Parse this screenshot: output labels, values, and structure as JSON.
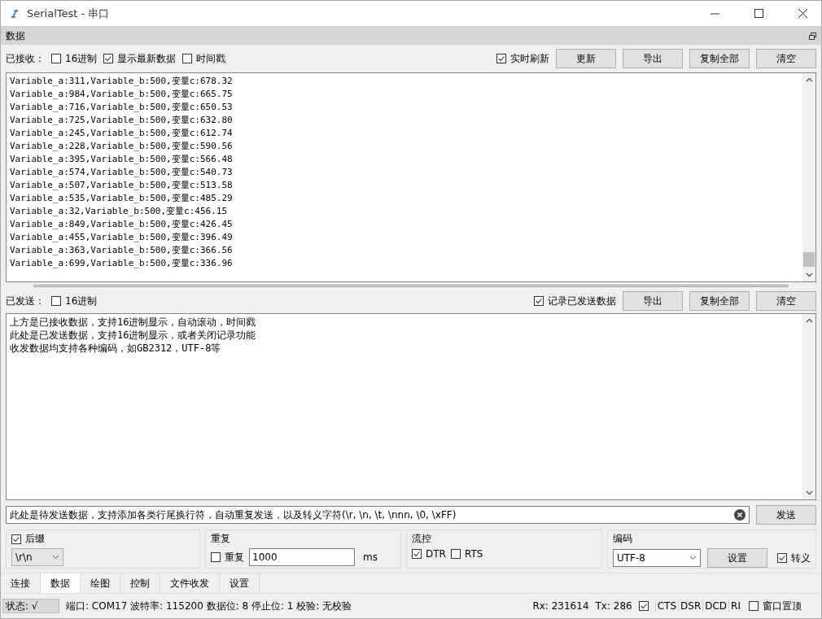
{
  "window": {
    "title": "SerialTest - 串口"
  },
  "panel": {
    "title": "数据"
  },
  "receive": {
    "label": "已接收：",
    "options": [
      {
        "label": "16进制",
        "checked": false
      },
      {
        "label": "显示最新数据",
        "checked": true
      },
      {
        "label": "时间戳",
        "checked": false
      }
    ],
    "realtime": {
      "label": "实时刷新",
      "checked": true
    },
    "buttons": [
      "更新",
      "导出",
      "复制全部",
      "清空"
    ],
    "lines": [
      "Variable_a:311,Variable_b:500,变量c:678.32",
      "Variable_a:984,Variable_b:500,变量c:665.75",
      "Variable_a:716,Variable_b:500,变量c:650.53",
      "Variable_a:725,Variable_b:500,变量c:632.80",
      "Variable_a:245,Variable_b:500,变量c:612.74",
      "Variable_a:228,Variable_b:500,变量c:590.56",
      "Variable_a:395,Variable_b:500,变量c:566.48",
      "Variable_a:574,Variable_b:500,变量c:540.73",
      "Variable_a:507,Variable_b:500,变量c:513.58",
      "Variable_a:535,Variable_b:500,变量c:485.29",
      "Variable_a:32,Variable_b:500,变量c:456.15",
      "Variable_a:849,Variable_b:500,变量c:426.45",
      "Variable_a:455,Variable_b:500,变量c:396.49",
      "Variable_a:363,Variable_b:500,变量c:366.56",
      "Variable_a:699,Variable_b:500,变量c:336.96"
    ]
  },
  "send": {
    "label": "已发送：",
    "options": [
      {
        "label": "16进制",
        "checked": false
      }
    ],
    "record": {
      "label": "记录已发送数据",
      "checked": true
    },
    "buttons": [
      "导出",
      "复制全部",
      "清空"
    ],
    "lines": [
      "上方是已接收数据，支持16进制显示，自动滚动，时间戳",
      "此处是已发送数据，支持16进制显示，或者关闭记录功能",
      "收发数据均支持各种编码，如GB2312，UTF-8等"
    ]
  },
  "input": {
    "value": "此处是待发送数据，支持添加各类行尾换行符，自动重复发送，以及转义字符(\\r, \\n, \\t, \\nnn, \\0, \\xFF)",
    "send_button": "发送"
  },
  "suffix": {
    "label": "后缀",
    "checked": true,
    "value": "\\r\\n"
  },
  "repeat": {
    "title": "重复",
    "label": "重复",
    "checked": false,
    "value": "1000",
    "unit": "ms"
  },
  "flow": {
    "title": "流控",
    "options": [
      {
        "label": "DTR",
        "checked": true
      },
      {
        "label": "RTS",
        "checked": false
      }
    ]
  },
  "encoding": {
    "title": "编码",
    "value": "UTF-8",
    "button": "设置",
    "escape": {
      "label": "转义",
      "checked": true
    }
  },
  "tabs": [
    {
      "label": "连接",
      "selected": false
    },
    {
      "label": "数据",
      "selected": true
    },
    {
      "label": "绘图",
      "selected": false
    },
    {
      "label": "控制",
      "selected": false
    },
    {
      "label": "文件收发",
      "selected": false
    },
    {
      "label": "设置",
      "selected": false
    }
  ],
  "status_bar": {
    "state": "状态: √",
    "port_info": "端口: COM17 波特率: 115200 数据位: 8 停止位: 1 校验: 无校验",
    "rx": "Rx: 231614",
    "tx": "Tx: 286",
    "signal_check": {
      "checked": true
    },
    "signals": [
      "CTS",
      "DSR",
      "DCD",
      "RI"
    ],
    "on_top": {
      "label": "窗口置顶",
      "checked": false
    }
  }
}
